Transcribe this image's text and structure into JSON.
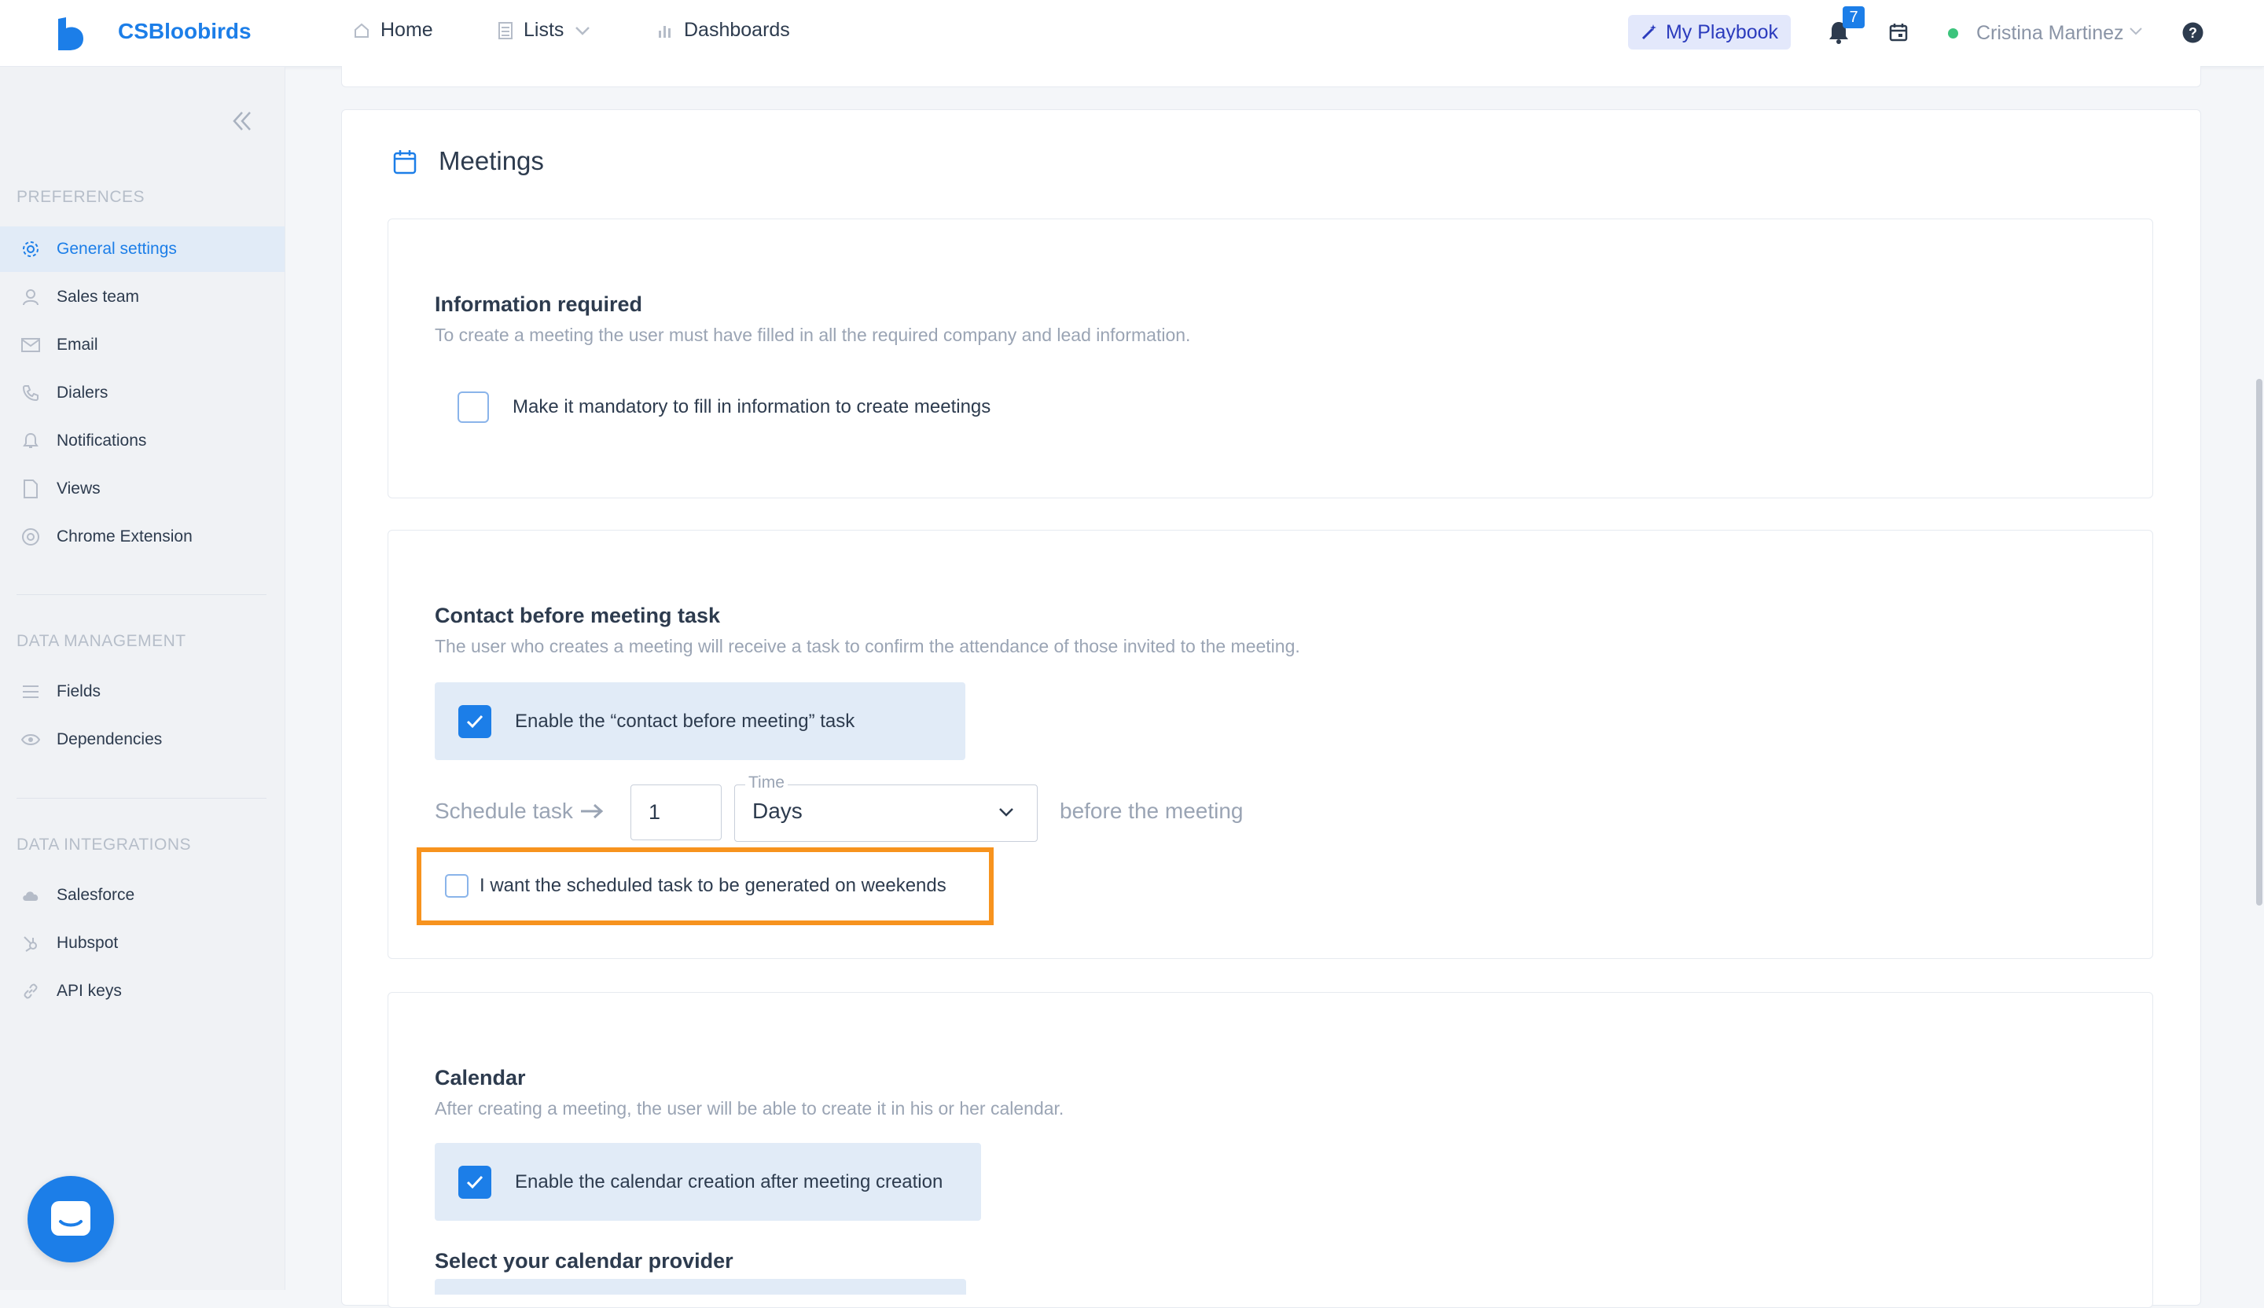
{
  "header": {
    "brand": "CSBloobirds",
    "nav": [
      {
        "label": "Home"
      },
      {
        "label": "Lists"
      },
      {
        "label": "Dashboards"
      }
    ],
    "playbook_label": "My Playbook",
    "notifications_count": "7",
    "user_name": "Cristina Martinez"
  },
  "sidebar": {
    "sections": [
      {
        "title": "PREFERENCES",
        "items": [
          {
            "label": "General settings",
            "icon": "gear-icon",
            "active": true
          },
          {
            "label": "Sales team",
            "icon": "user-icon"
          },
          {
            "label": "Email",
            "icon": "mail-icon"
          },
          {
            "label": "Dialers",
            "icon": "phone-icon"
          },
          {
            "label": "Notifications",
            "icon": "bell-icon"
          },
          {
            "label": "Views",
            "icon": "file-icon"
          },
          {
            "label": "Chrome Extension",
            "icon": "chrome-icon"
          }
        ]
      },
      {
        "title": "DATA MANAGEMENT",
        "items": [
          {
            "label": "Fields",
            "icon": "list-icon"
          },
          {
            "label": "Dependencies",
            "icon": "eye-icon"
          }
        ]
      },
      {
        "title": "DATA INTEGRATIONS",
        "items": [
          {
            "label": "Salesforce",
            "icon": "cloud-icon"
          },
          {
            "label": "Hubspot",
            "icon": "hubspot-icon"
          },
          {
            "label": "API keys",
            "icon": "link-icon"
          }
        ]
      }
    ]
  },
  "main": {
    "title": "Meetings",
    "info_required": {
      "heading": "Information required",
      "description": "To create a meeting the user must have filled in all the required company and lead information.",
      "checkbox_label": "Make it mandatory to fill in information to create meetings",
      "checked": false
    },
    "contact_before": {
      "heading": "Contact before meeting task",
      "description": "The user who creates a meeting will receive a task to confirm the attendance of those invited to the meeting.",
      "checkbox_label": "Enable the “contact before meeting” task",
      "checked": true,
      "schedule_label": "Schedule task",
      "schedule_value": "1",
      "time_legend": "Time",
      "time_value": "Days",
      "before_label": "before the meeting",
      "weekend_label": "I want the scheduled task to be generated on weekends",
      "weekend_checked": false
    },
    "calendar": {
      "heading": "Calendar",
      "description": "After creating a meeting, the user will be able to create it in his or her calendar.",
      "checkbox_label": "Enable the calendar creation after meeting creation",
      "checked": true,
      "provider_label": "Select your calendar provider"
    }
  },
  "colors": {
    "accent": "#1c7ee8",
    "highlight": "#f7931e",
    "active_bg": "#e1ebf7"
  }
}
